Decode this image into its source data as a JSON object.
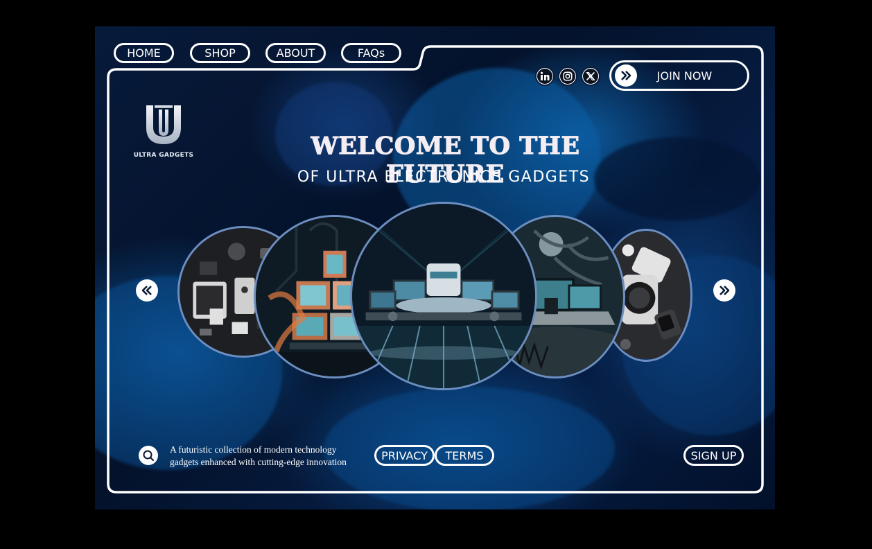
{
  "nav": {
    "home": "HOME",
    "shop": "SHOP",
    "about": "ABOUT",
    "faqs": "FAQs"
  },
  "social": [
    "linkedin-icon",
    "instagram-icon",
    "x-icon"
  ],
  "join": {
    "label": "JOIN NOW",
    "icon": "double-chevron-right-icon"
  },
  "logo": {
    "letter": "U",
    "brand": "ULTRA GADGETS"
  },
  "hero": {
    "headline": "WELCOME TO THE FUTURE",
    "subheadline": "OF ULTRA ELECTRONICS GADGETS"
  },
  "gallery": {
    "prev_icon": "double-chevron-left-icon",
    "next_icon": "double-chevron-right-icon",
    "slides": [
      "gadget-collection-image",
      "retro-tvs-image",
      "futuristic-devices-image",
      "laptops-tree-image",
      "smartwatch-image"
    ]
  },
  "footer": {
    "search_icon": "search-icon",
    "tagline_line1": "A futuristic collection of modern technology",
    "tagline_line2": "gadgets enhanced with cutting-edge innovation",
    "privacy": "PRIVACY",
    "terms": "TERMS",
    "signup": "SIGN UP"
  },
  "colors": {
    "background": "#000000",
    "panel": "#061d44",
    "accent_blue": "#0d5a9c",
    "frame": "#ffffff",
    "circle_border": "#6d8ec0"
  }
}
